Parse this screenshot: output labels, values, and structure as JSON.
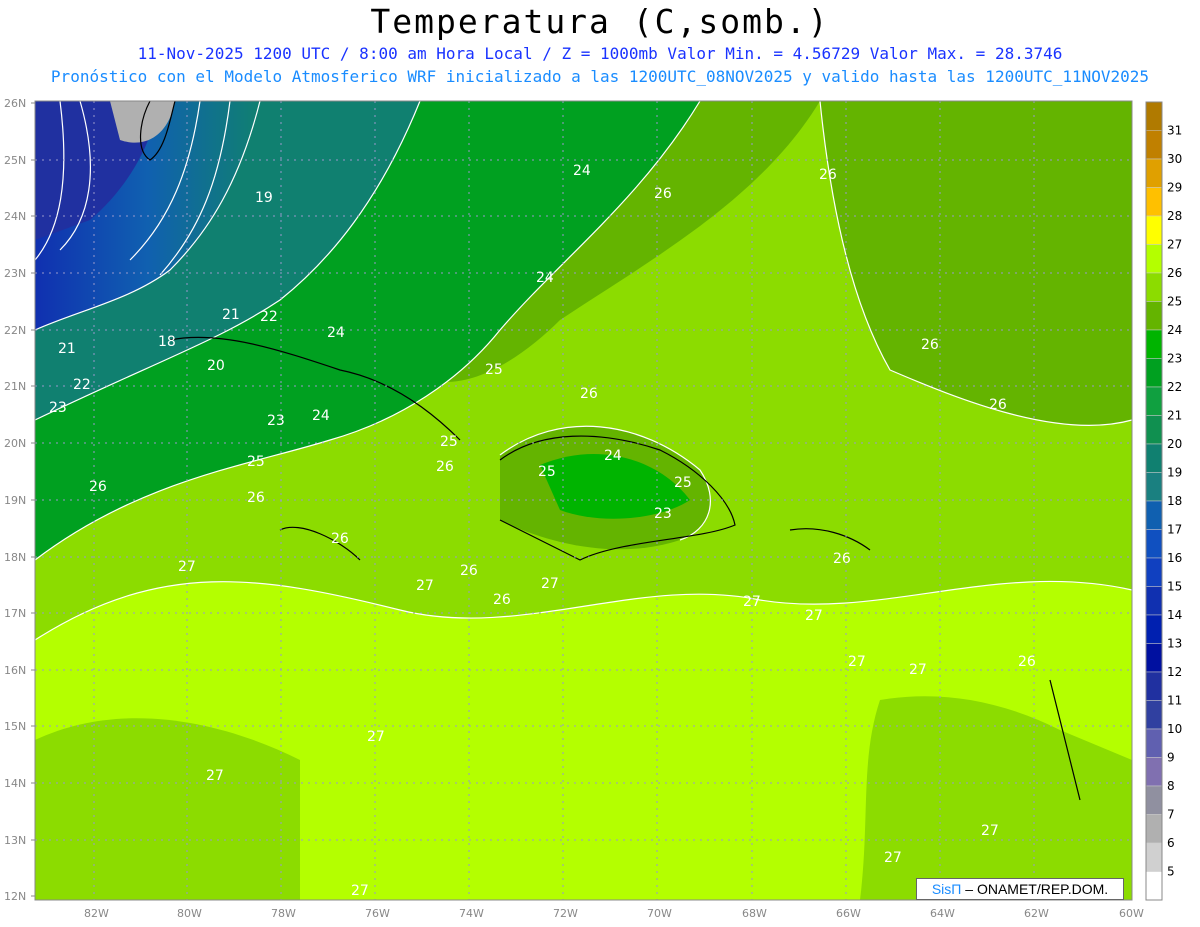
{
  "header": {
    "title": "Temperatura (C,somb.)",
    "line1": "11-Nov-2025  1200 UTC / 8:00 am Hora Local / Z = 1000mb   Valor Min. = 4.56729  Valor Max. = 28.3746",
    "line2": "Pronóstico con el Modelo Atmosferico WRF inicializado a las 1200UTC_08NOV2025 y valido hasta las  1200UTC_11NOV2025"
  },
  "axes": {
    "lat_labels": [
      "26N",
      "25N",
      "24N",
      "23N",
      "22N",
      "21N",
      "20N",
      "19N",
      "18N",
      "17N",
      "16N",
      "15N",
      "14N",
      "13N",
      "12N"
    ],
    "lon_labels": [
      "82W",
      "80W",
      "78W",
      "76W",
      "74W",
      "72W",
      "70W",
      "68W",
      "66W",
      "64W",
      "62W",
      "60W"
    ]
  },
  "colorbar": {
    "levels": [
      "31",
      "30",
      "29",
      "28",
      "27",
      "26",
      "25",
      "24",
      "23",
      "22",
      "21",
      "20",
      "19",
      "18",
      "17",
      "16",
      "15",
      "14",
      "13",
      "12",
      "11",
      "10",
      "9",
      "8",
      "7",
      "6",
      "5"
    ],
    "colors": [
      "#c08000",
      "#e0a000",
      "#ffc000",
      "#ffff00",
      "#b4ff00",
      "#8cdc00",
      "#64b400",
      "#00b400",
      "#00a020",
      "#10a040",
      "#109050",
      "#108070",
      "#1a8080",
      "#1060b0",
      "#1050c0",
      "#1040c0",
      "#1030b0",
      "#0020b0",
      "#0010a0",
      "#2030a0",
      "#3040a0",
      "#6060b0",
      "#8070b0",
      "#9090a0",
      "#b0b0b0",
      "#d0d0d0",
      "#ffffff"
    ]
  },
  "contour_labels": [
    "19",
    "21",
    "22",
    "18",
    "20",
    "24",
    "21",
    "22",
    "23",
    "23",
    "24",
    "25",
    "24",
    "25",
    "26",
    "26",
    "26",
    "26",
    "24",
    "25",
    "25",
    "26",
    "24",
    "23",
    "25",
    "26",
    "27",
    "27",
    "27",
    "26",
    "26",
    "27",
    "27",
    "26",
    "27",
    "27",
    "27",
    "26",
    "27",
    "27",
    "27",
    "27",
    "26",
    "26",
    "26"
  ],
  "credit": {
    "system": "SisΠ",
    "org": " – ONAMET/REP.DOM."
  }
}
